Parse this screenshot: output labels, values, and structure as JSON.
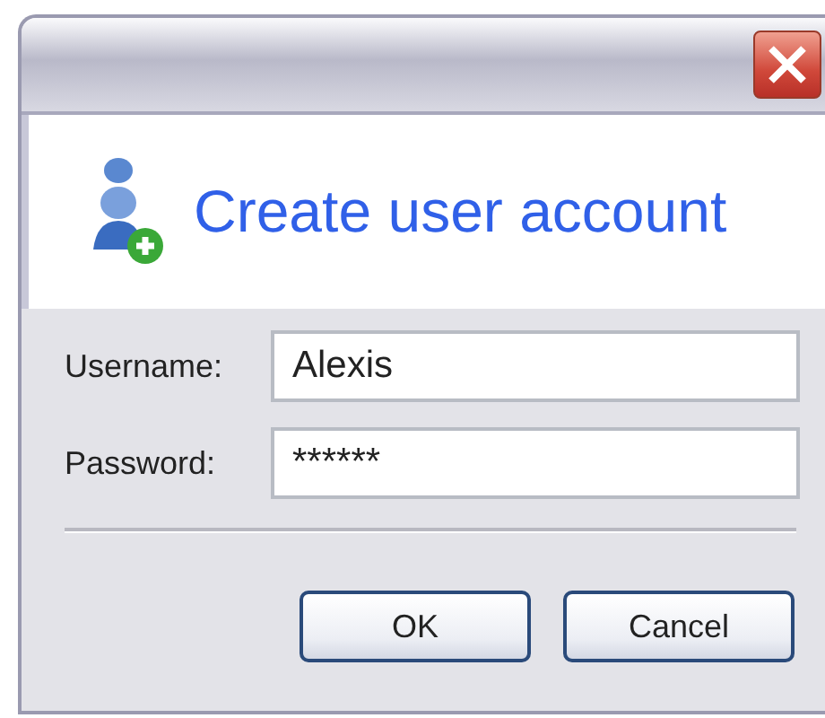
{
  "header": {
    "title": "Create user account"
  },
  "fields": [
    {
      "label": "Username:",
      "value": "Alexis"
    },
    {
      "label": "Password:",
      "value": "******"
    }
  ],
  "buttons": [
    "OK",
    "Cancel"
  ]
}
